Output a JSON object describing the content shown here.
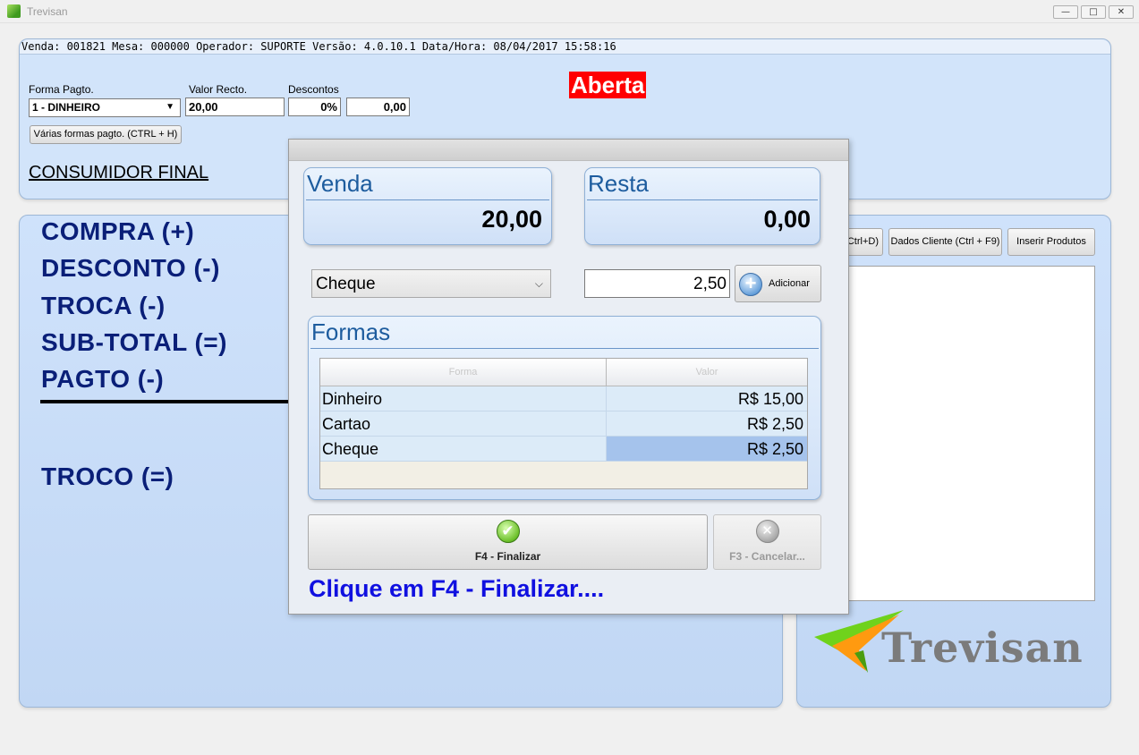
{
  "window": {
    "title": "Trevisan",
    "minimize_glyph": "—",
    "maximize_glyph": "□",
    "close_glyph": "✕"
  },
  "info_line": "Venda: 001821 Mesa: 000000 Operador: SUPORTE Versão: 4.0.10.1 Data/Hora: 08/04/2017 15:58:16",
  "payment_header": {
    "forma_label": "Forma Pagto.",
    "forma_value": "1 - DINHEIRO",
    "valor_label": "Valor Recto.",
    "valor_value": "20,00",
    "descontos_label": "Descontos",
    "desconto_percent": "0%",
    "desconto_value": "0,00",
    "varias_button": "Várias formas pagto. (CTRL + H)",
    "status": "Aberta",
    "customer": "CONSUMIDOR FINAL"
  },
  "totals": {
    "compra": "COMPRA (+)",
    "desconto": "DESCONTO (-)",
    "troca": "TROCA (-)",
    "subtotal": "SUB-TOTAL (=)",
    "pagto": "PAGTO (-)",
    "troco": "TROCO (=)"
  },
  "right_panel": {
    "btn_partial": "Ctrl+D)",
    "btn_dados_cliente": "Dados Cliente (Ctrl + F9)",
    "btn_inserir": "Inserir Produtos",
    "logo_text": "Trevisan"
  },
  "dialog": {
    "venda_label": "Venda",
    "venda_value": "20,00",
    "resta_label": "Resta",
    "resta_value": "0,00",
    "selected_payment": "Cheque",
    "amount": "2,50",
    "add_button": "Adicionar",
    "formas_title": "Formas",
    "table": {
      "columns": [
        "Forma",
        "Valor"
      ],
      "rows": [
        {
          "forma": "Dinheiro",
          "valor": "R$ 15,00"
        },
        {
          "forma": "Cartao",
          "valor": "R$ 2,50"
        },
        {
          "forma": "Cheque",
          "valor": "R$ 2,50"
        }
      ]
    },
    "finish_button": "F4 - Finalizar",
    "cancel_button": "F3 - Cancelar...",
    "hint": "Clique em F4 - Finalizar...."
  },
  "colors": {
    "panel": "#cfe1f8",
    "status_bg": "#ff0000",
    "totals_text": "#0a1f78",
    "hint_text": "#1010e0"
  }
}
